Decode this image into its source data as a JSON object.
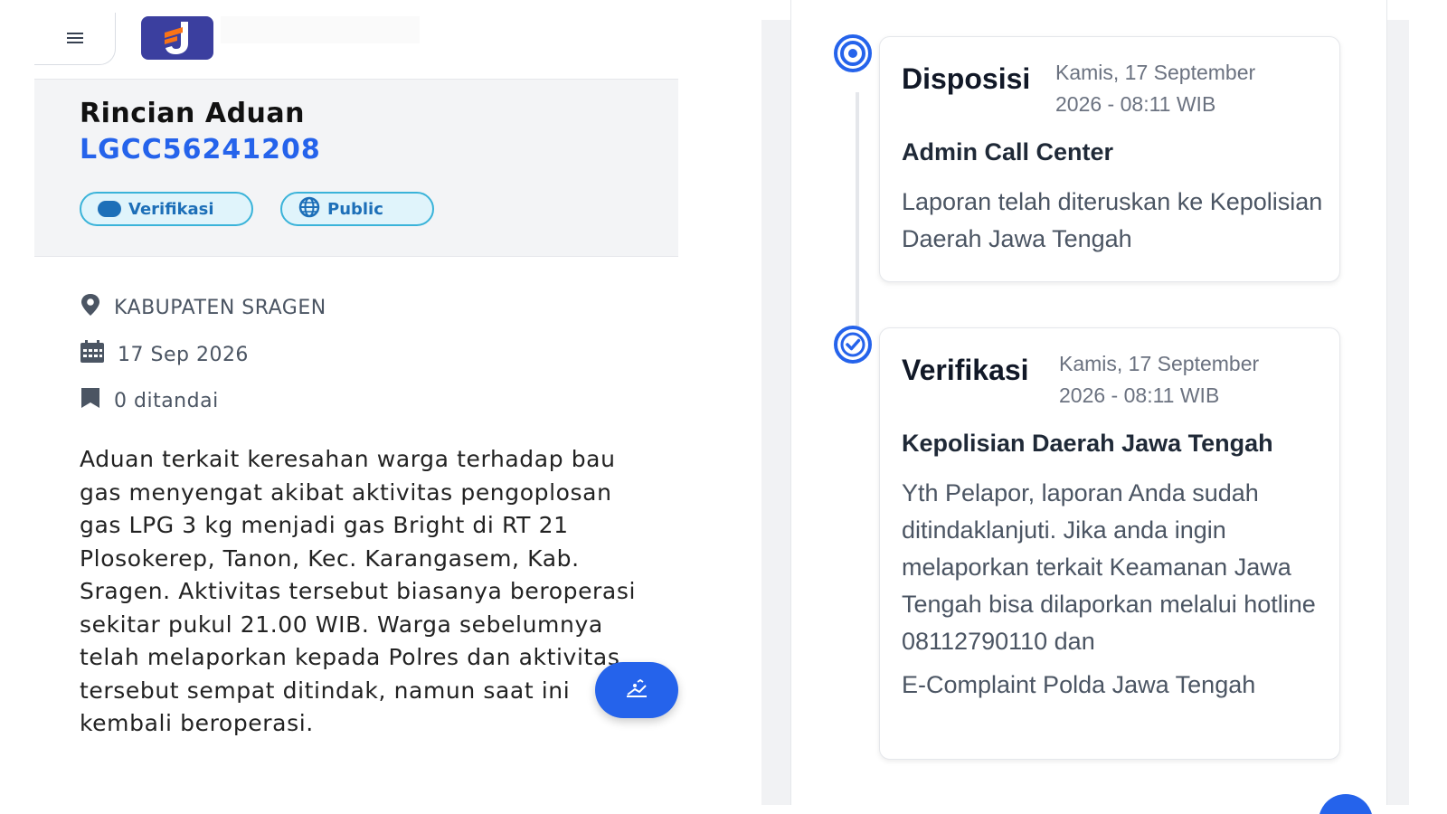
{
  "header": {
    "menu_icon": "hamburger-icon",
    "logo_icon": "app-logo"
  },
  "complaint": {
    "title": "Rincian Aduan",
    "ticket_id": "LGCC56241208",
    "status_chip": "Verifikasi",
    "visibility_chip": "Public",
    "location": "KABUPATEN SRAGEN",
    "date": "17 Sep 2026",
    "bookmarks": "0 ditandai",
    "description": "Aduan terkait keresahan warga terhadap bau gas menyengat akibat aktivitas pengoplosan gas LPG 3 kg menjadi gas Bright di RT 21 Plosokerep, Tanon, Kec. Karangasem, Kab. Sragen. Aktivitas tersebut biasanya beroperasi sekitar pukul 21.00 WIB. Warga sebelumnya telah melaporkan kepada Polres dan aktivitas tersebut sempat ditindak, namun saat ini kembali beroperasi."
  },
  "timeline": [
    {
      "status": "Disposisi",
      "time": "Kamis, 17 September 2026 - 08:11 WIB",
      "actor": "Admin Call Center",
      "message": "Laporan telah diteruskan ke Kepolisian Daerah Jawa Tengah",
      "icon": "target-icon"
    },
    {
      "status": "Verifikasi",
      "time": "Kamis, 17 September 2026 - 08:11 WIB",
      "actor": "Kepolisian Daerah Jawa Tengah",
      "message": "Yth Pelapor, laporan Anda sudah ditindaklanjuti. Jika anda ingin melaporkan terkait Keamanan Jawa Tengah bisa dilaporkan melalui hotline 08112790110 dan",
      "message_extra": "E-Complaint Polda Jawa Tengah",
      "icon": "check-circle-icon"
    }
  ],
  "colors": {
    "accent": "#2563eb",
    "chip_border": "#3ab3d9",
    "chip_bg": "#e0f4fb",
    "logo_bg": "#3b3f9f"
  }
}
